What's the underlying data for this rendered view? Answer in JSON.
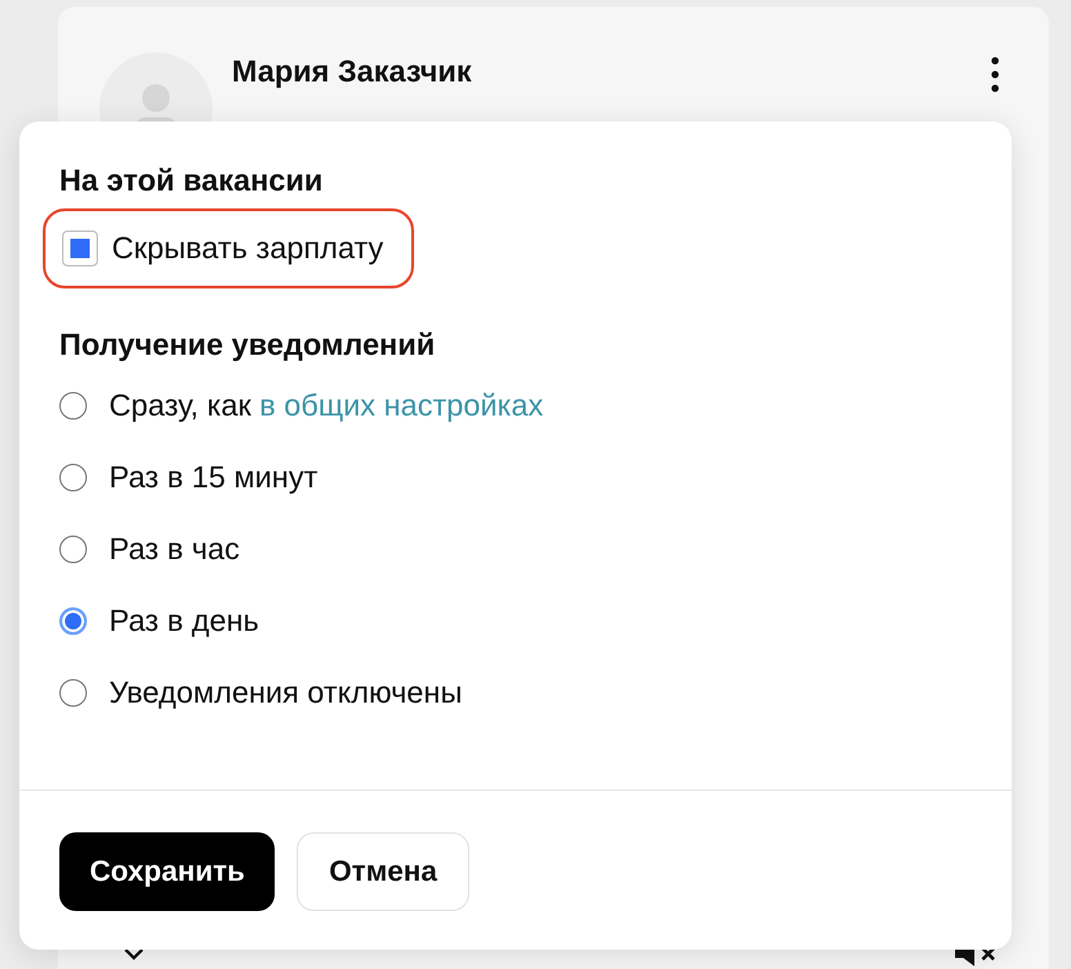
{
  "background_card": {
    "name": "Мария Заказчик"
  },
  "popup": {
    "section_title": "На этой вакансии",
    "checkbox": {
      "label": "Скрывать зарплату",
      "checked": true,
      "highlighted": true
    },
    "notifications_title": "Получение уведомлений",
    "options": [
      {
        "label": "Сразу, как",
        "link": "в общих настройках",
        "selected": false
      },
      {
        "label": "Раз в 15 минут",
        "selected": false
      },
      {
        "label": "Раз в час",
        "selected": false
      },
      {
        "label": "Раз в день",
        "selected": true
      },
      {
        "label": "Уведомления отключены",
        "selected": false
      }
    ],
    "buttons": [
      {
        "label": "Сохранить",
        "kind": "primary"
      },
      {
        "label": "Отмена",
        "kind": "secondary"
      }
    ]
  }
}
